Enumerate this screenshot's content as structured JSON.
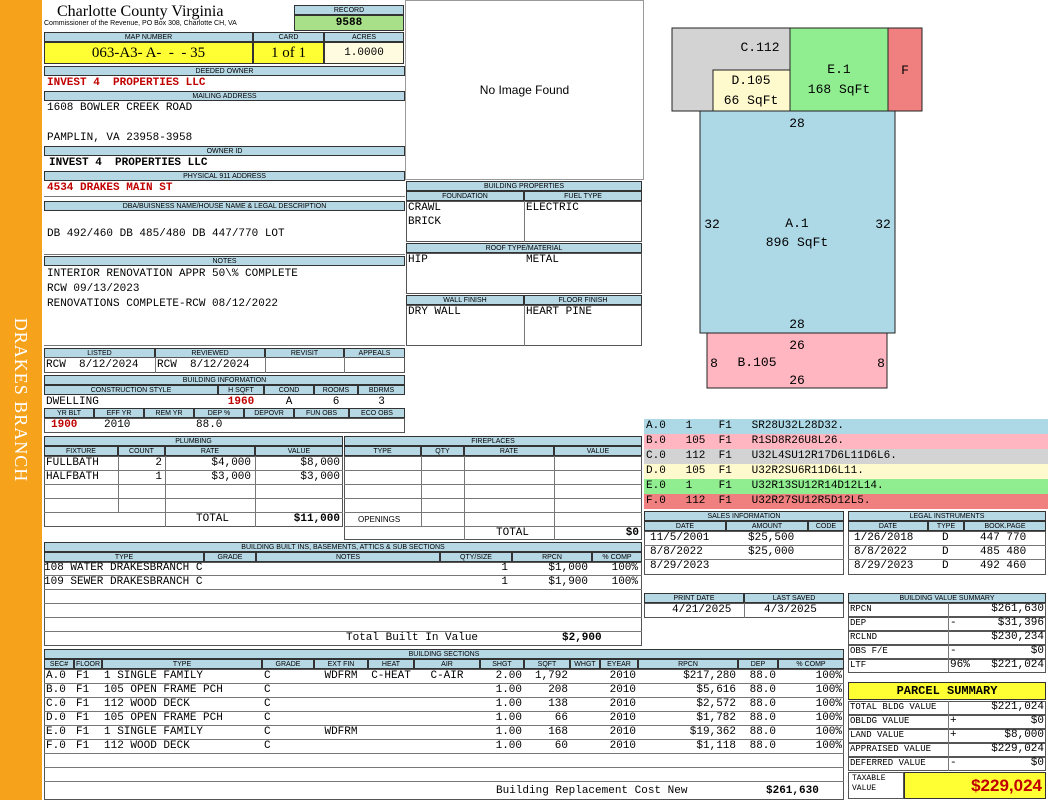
{
  "side_label": "DRAKES BRANCH",
  "county": "Charlotte County Virginia",
  "commissioner": "Commissioner of the Revenue, PO Box 308, Charlotte CH, VA",
  "labels": {
    "record": "RECORD",
    "map_number": "MAP NUMBER",
    "card": "CARD",
    "acres": "ACRES",
    "deeded_owner": "DEEDED OWNER",
    "mailing": "MAILING ADDRESS",
    "owner_id": "OWNER ID",
    "physical": "PHYSICAL 911 ADDRESS",
    "dba": "DBA/BUISNESS NAME/HOUSE NAME & LEGAL DESCRIPTION",
    "notes": "NOTES",
    "listed": "LISTED",
    "reviewed": "REVIEWED",
    "revisit": "REVISIT",
    "appeals": "APPEALS",
    "bldg_info": "BUILDING INFORMATION",
    "construction_style": "CONSTRUCTION STYLE",
    "hsqft": "H SQFT",
    "cond": "COND",
    "rooms": "ROOMS",
    "bdrms": "BDRMS",
    "yr_blt": "YR BLT",
    "eff_yr": "EFF YR",
    "rem_yr": "REM YR",
    "dep_pct": "DEP %",
    "depovr": "DEPOVR",
    "fun_obs": "FUN OBS",
    "eco_obs": "ECO OBS",
    "bldg_props": "BUILDING PROPERTIES",
    "foundation": "FOUNDATION",
    "fuel_type": "FUEL TYPE",
    "roof": "ROOF TYPE/MATERIAL",
    "wall": "WALL FINISH",
    "floor": "FLOOR FINISH",
    "plumbing": "PLUMBING",
    "fixture": "FIXTURE",
    "count": "COUNT",
    "rate": "RATE",
    "value": "VALUE",
    "total": "TOTAL",
    "fireplaces": "FIREPLACES",
    "type": "TYPE",
    "qty": "QTY",
    "openings": "OPENINGS",
    "builtins": "BUILDING BUILT INS, BASEMENTS, ATTICS & SUB SECTIONS",
    "grade": "GRADE",
    "notes_col": "NOTES",
    "qty_size": "QTY/SIZE",
    "rpcn": "RPCN",
    "pct_comp": "% COMP",
    "total_builtin": "Total Built In Value",
    "bldg_sections": "BUILDING SECTIONS",
    "sales": "SALES INFORMATION",
    "date": "DATE",
    "amount": "AMOUNT",
    "code": "CODE",
    "legal": "LEGAL INSTRUMENTS",
    "bookpage": "BOOK.PAGE",
    "print_date": "PRINT DATE",
    "last_saved": "LAST SAVED",
    "bvs": "BUILDING VALUE SUMMARY",
    "parcel_summary": "PARCEL SUMMARY",
    "taxable": "TAXABLE VALUE",
    "brcn": "Building Replacement Cost New",
    "no_image": "No Image Found"
  },
  "record": "9588",
  "map_number": "063-A3- A-  -  - 35",
  "card": "1 of 1",
  "acres": "1.0000",
  "deeded_owner": "INVEST 4  PROPERTIES LLC",
  "mailing1": "1608 BOWLER CREEK ROAD",
  "mailing2": "PAMPLIN, VA 23958-3958",
  "owner_id": "INVEST 4  PROPERTIES LLC",
  "physical": "4534 DRAKES MAIN ST",
  "dba": "DB 492/460 DB 485/480 DB 447/770 LOT",
  "notes": [
    "INTERIOR RENOVATION APPR 50\\% COMPLETE",
    "RCW 09/13/2023",
    "RENOVATIONS COMPLETE-RCW 08/12/2022"
  ],
  "listed": "RCW  8/12/2024",
  "reviewed": "RCW  8/12/2024",
  "construction_style": "DWELLING",
  "hsqft": "1960",
  "cond": "A",
  "rooms": "6",
  "bdrms": "3",
  "yr_blt": "1900",
  "eff_yr": "2010",
  "rem_yr": "",
  "dep_pct": "88.0",
  "foundation": [
    "CRAWL",
    "BRICK"
  ],
  "fuel": "ELECTRIC",
  "roof_type": "HIP",
  "roof_mat": "METAL",
  "wall": "DRY WALL",
  "floor": "HEART PINE",
  "plumbing": [
    {
      "fixture": "FULLBATH",
      "count": "2",
      "rate": "$4,000",
      "value": "$8,000"
    },
    {
      "fixture": "HALFBATH",
      "count": "1",
      "rate": "$3,000",
      "value": "$3,000"
    }
  ],
  "plumbing_total": "$11,000",
  "fireplace_total": "$0",
  "builtins": [
    {
      "type": "108 WATER DRAKESBRANCH C",
      "qty": "1",
      "rpcn": "$1,000",
      "pct": "100%"
    },
    {
      "type": "109 SEWER DRAKESBRANCH C",
      "qty": "1",
      "rpcn": "$1,900",
      "pct": "100%"
    }
  ],
  "builtin_total": "$2,900",
  "sections_header": [
    "SEC#",
    "FLOOR",
    "TYPE",
    "GRADE",
    "EXT FIN",
    "HEAT",
    "AIR",
    "SHGT",
    "SQFT",
    "WHGT",
    "EYEAR",
    "RPCN",
    "DEP",
    "% COMP"
  ],
  "sections": [
    {
      "sec": "A.0",
      "floor": "F1",
      "type": "1 SINGLE FAMILY",
      "grade": "C",
      "ext": "WDFRM",
      "heat": "C-HEAT",
      "air": "C-AIR",
      "shgt": "2.00",
      "sqft": "1,792",
      "eyear": "2010",
      "rpcn": "$217,280",
      "dep": "88.0",
      "comp": "100%"
    },
    {
      "sec": "B.0",
      "floor": "F1",
      "type": "105 OPEN FRAME PCH",
      "grade": "C",
      "ext": "",
      "heat": "",
      "air": "",
      "shgt": "1.00",
      "sqft": "208",
      "eyear": "2010",
      "rpcn": "$5,616",
      "dep": "88.0",
      "comp": "100%"
    },
    {
      "sec": "C.0",
      "floor": "F1",
      "type": "112 WOOD DECK",
      "grade": "C",
      "ext": "",
      "heat": "",
      "air": "",
      "shgt": "1.00",
      "sqft": "138",
      "eyear": "2010",
      "rpcn": "$2,572",
      "dep": "88.0",
      "comp": "100%"
    },
    {
      "sec": "D.0",
      "floor": "F1",
      "type": "105 OPEN FRAME PCH",
      "grade": "C",
      "ext": "",
      "heat": "",
      "air": "",
      "shgt": "1.00",
      "sqft": "66",
      "eyear": "2010",
      "rpcn": "$1,782",
      "dep": "88.0",
      "comp": "100%"
    },
    {
      "sec": "E.0",
      "floor": "F1",
      "type": "1 SINGLE FAMILY",
      "grade": "C",
      "ext": "WDFRM",
      "heat": "",
      "air": "",
      "shgt": "1.00",
      "sqft": "168",
      "eyear": "2010",
      "rpcn": "$19,362",
      "dep": "88.0",
      "comp": "100%"
    },
    {
      "sec": "F.0",
      "floor": "F1",
      "type": "112 WOOD DECK",
      "grade": "C",
      "ext": "",
      "heat": "",
      "air": "",
      "shgt": "1.00",
      "sqft": "60",
      "eyear": "2010",
      "rpcn": "$1,118",
      "dep": "88.0",
      "comp": "100%"
    }
  ],
  "brcn": "$261,630",
  "sketch": {
    "c112": "C.112",
    "d105": "D.105",
    "d105_sqft": "66 SqFt",
    "e1": "E.1",
    "e1_sqft": "168 SqFt",
    "f": "F",
    "a1": "A.1",
    "a1_sqft": "896 SqFt",
    "b105": "B.105",
    "dim28a": "28",
    "dim32l": "32",
    "dim32r": "32",
    "dim28b": "28",
    "dim26a": "26",
    "dim8l": "8",
    "dim8r": "8",
    "dim26b": "26"
  },
  "vectors": [
    {
      "text": "A.0   1    F1   SR28U32L28D32.",
      "color": "#add8e6"
    },
    {
      "text": "B.0   105  F1   R1SD8R26U8L26.",
      "color": "#ffb6c1"
    },
    {
      "text": "C.0   112  F1   U32L4SU12R17D6L11D6L6.",
      "color": "#d3d3d3"
    },
    {
      "text": "D.0   105  F1   U32R2SU6R11D6L11.",
      "color": "#fffacd"
    },
    {
      "text": "E.0   1    F1   U32R13SU12R14D12L14.",
      "color": "#90ee90"
    },
    {
      "text": "F.0   112  F1   U32R27SU12R5D12L5.",
      "color": "#f08080"
    }
  ],
  "sales": [
    {
      "date": "11/5/2001",
      "amount": "$25,500"
    },
    {
      "date": "8/8/2022",
      "amount": "$25,000"
    },
    {
      "date": "8/29/2023",
      "amount": ""
    }
  ],
  "legal": [
    {
      "date": "1/26/2018",
      "type": "D",
      "bp": "447 770"
    },
    {
      "date": "8/8/2022",
      "type": "D",
      "bp": "485 480"
    },
    {
      "date": "8/29/2023",
      "type": "D",
      "bp": "492 460"
    }
  ],
  "print_date": "4/21/2025",
  "last_saved": "4/3/2025",
  "bvs": [
    {
      "label": "RPCN",
      "sign": "",
      "value": "$261,630"
    },
    {
      "label": "DEP",
      "sign": "-",
      "value": "$31,396"
    },
    {
      "label": "RCLND",
      "sign": "",
      "value": "$230,234"
    },
    {
      "label": "OBS F/E",
      "sign": "-",
      "value": "$0"
    },
    {
      "label": "LTF",
      "sign": "96%",
      "value": "$221,024"
    }
  ],
  "parcel": [
    {
      "label": "TOTAL BLDG VALUE",
      "sign": "",
      "value": "$221,024"
    },
    {
      "label": "OBLDG VALUE",
      "sign": "+",
      "value": "$0"
    },
    {
      "label": "LAND VALUE",
      "sign": "+",
      "value": "$8,000"
    },
    {
      "label": "APPRAISED VALUE",
      "sign": "",
      "value": "$229,024"
    },
    {
      "label": "DEFERRED VALUE",
      "sign": "-",
      "value": "$0"
    }
  ],
  "taxable_value": "$229,024"
}
